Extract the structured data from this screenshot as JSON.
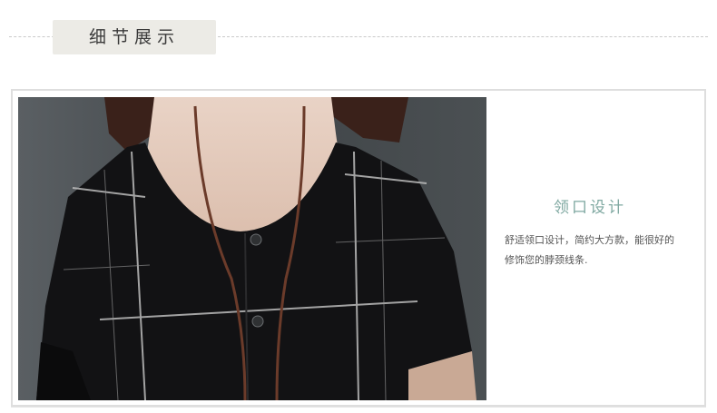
{
  "header": {
    "title": "细节展示"
  },
  "detail": {
    "heading": "领口设计",
    "description_line1": "舒适领口设计，简约大方款，能很好的",
    "description_line2": "修饰您的脖颈线条."
  },
  "photo": {
    "subject": "model-neckline-closeup"
  },
  "colors": {
    "accent": "#7fa8a1",
    "plate": "#ecebe6",
    "garment": "#121214"
  }
}
